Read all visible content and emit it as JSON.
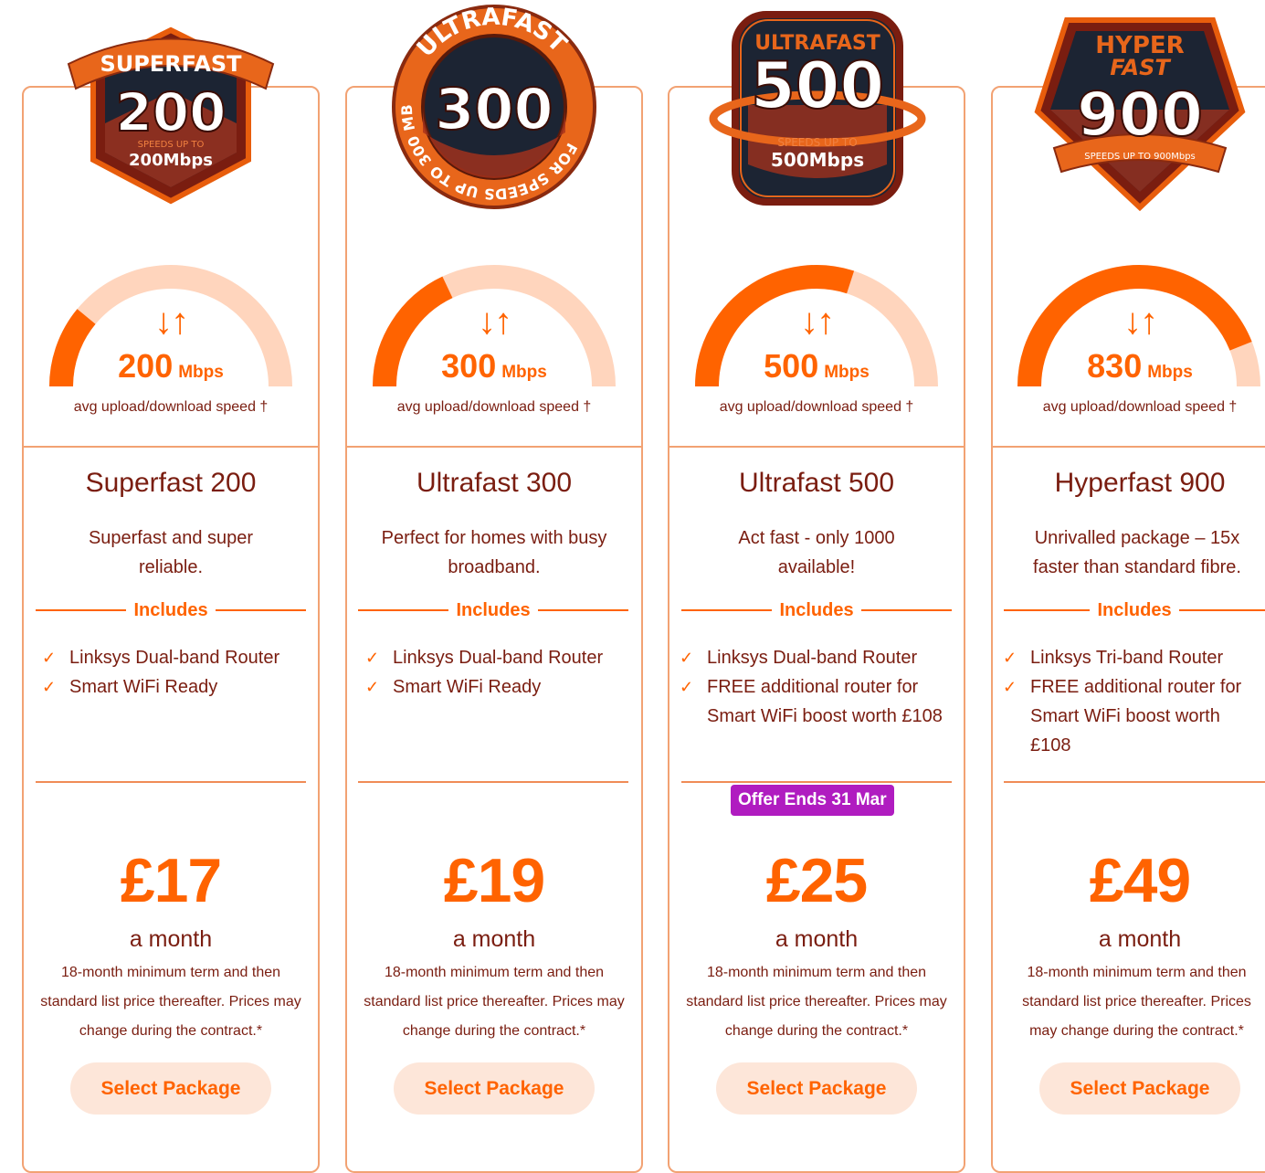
{
  "accent_color": "#ff6300",
  "text_color": "#7a1d10",
  "packages": [
    {
      "badge": {
        "top": "SUPERFAST",
        "number": "200",
        "speed_small": "SPEEDS UP TO",
        "speed_big": "200Mbps"
      },
      "speed_value": "200",
      "speed_unit": "Mbps",
      "speed_fraction": 0.22,
      "arrows": "↓↑",
      "speed_caption": "avg upload/download speed †",
      "name": "Superfast 200",
      "description": "Superfast and super reliable.",
      "includes_label": "Includes",
      "features": [
        "Linksys Dual-band Router",
        "Smart WiFi Ready"
      ],
      "offer": "",
      "price": "£17",
      "per": "a month",
      "terms": "18-month minimum term and then standard list price thereafter. Prices may change during the contract.*",
      "button": "Select Package"
    },
    {
      "badge": {
        "top": "ULTRAFAST",
        "number": "300",
        "ring": "FOR SPEEDS UP TO 300 MBS"
      },
      "speed_value": "300",
      "speed_unit": "Mbps",
      "speed_fraction": 0.36,
      "arrows": "↓↑",
      "speed_caption": "avg upload/download speed †",
      "name": "Ultrafast 300",
      "description": "Perfect for homes with busy broadband.",
      "includes_label": "Includes",
      "features": [
        "Linksys Dual-band Router",
        "Smart WiFi Ready"
      ],
      "offer": "",
      "price": "£19",
      "per": "a month",
      "terms": "18-month minimum term and then standard list price thereafter. Prices may change during the contract.*",
      "button": "Select Package"
    },
    {
      "badge": {
        "top": "ULTRAFAST",
        "number": "500",
        "speed_small": "SPEEDS UP TO",
        "speed_big": "500Mbps"
      },
      "speed_value": "500",
      "speed_unit": "Mbps",
      "speed_fraction": 0.6,
      "arrows": "↓↑",
      "speed_caption": "avg upload/download speed †",
      "name": "Ultrafast 500",
      "description": "Act fast - only 1000 available!",
      "includes_label": "Includes",
      "features": [
        "Linksys Dual-band Router",
        "FREE additional router for Smart WiFi boost worth £108"
      ],
      "offer": "Offer Ends 31 Mar",
      "price": "£25",
      "per": "a month",
      "terms": "18-month minimum term and then standard list price thereafter. Prices may change during the contract.*",
      "button": "Select Package"
    },
    {
      "badge": {
        "top": "HYPER",
        "top2": "FAST",
        "number": "900",
        "speed_small": "SPEEDS UP TO 900Mbps"
      },
      "speed_value": "830",
      "speed_unit": "Mbps",
      "speed_fraction": 0.88,
      "arrows": "↓↑",
      "speed_caption": "avg upload/download speed †",
      "name": "Hyperfast 900",
      "description": "Unrivalled package – 15x faster than standard fibre.",
      "includes_label": "Includes",
      "features": [
        "Linksys Tri-band Router",
        "FREE additional router for Smart WiFi boost worth £108"
      ],
      "offer": "",
      "price": "£49",
      "per": "a month",
      "terms": "18-month minimum term and then standard list price thereafter. Prices may change during the contract.*",
      "button": "Select Package"
    }
  ]
}
